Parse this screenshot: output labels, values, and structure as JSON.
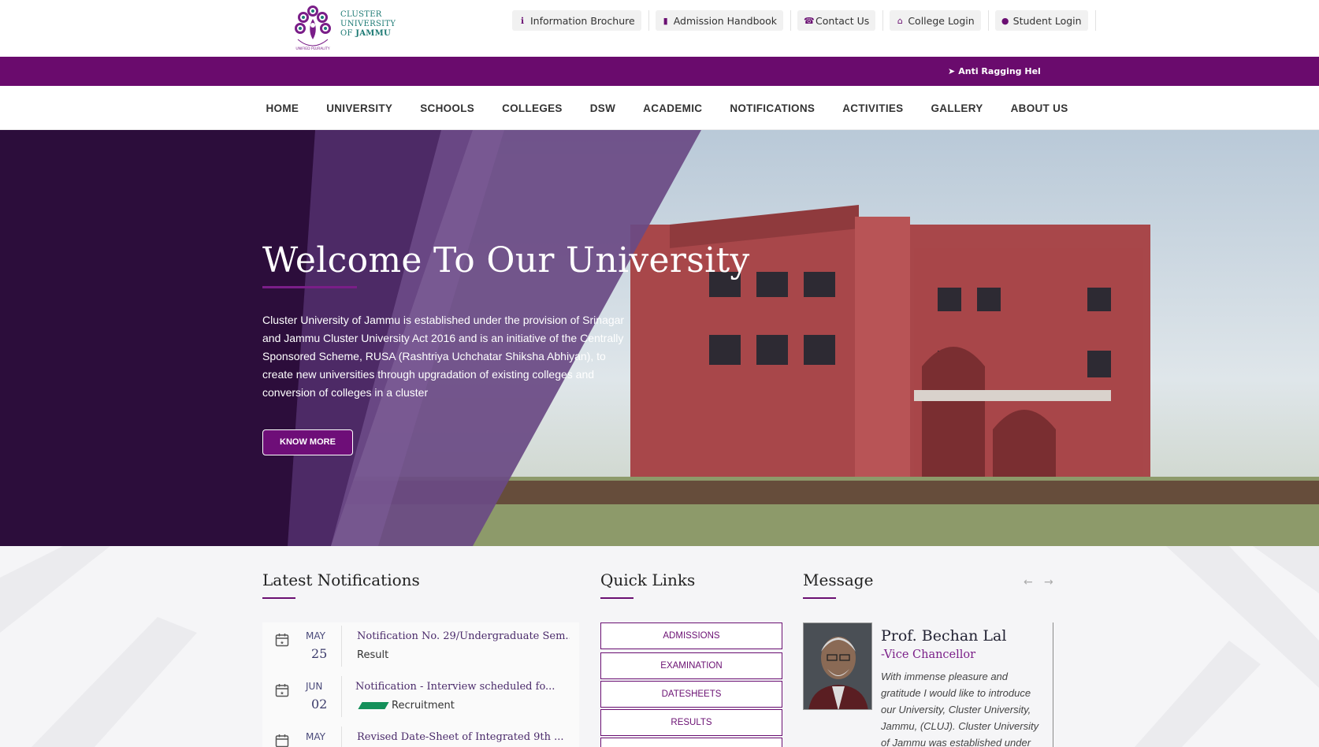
{
  "header": {
    "logo": {
      "line1": "CLUSTER",
      "line2": "UNIVERSITY",
      "line3_prefix": "OF ",
      "line3_bold": "JAMMU",
      "tagline": "UNIFIED PLURALITY"
    },
    "utility_links": [
      {
        "label": "Information Brochure",
        "icon": "info-icon"
      },
      {
        "label": "Admission Handbook",
        "icon": "document-icon"
      },
      {
        "label": "Contact Us",
        "icon": "phone-icon"
      },
      {
        "label": "College Login",
        "icon": "bank-icon"
      },
      {
        "label": "Student Login",
        "icon": "user-icon"
      }
    ]
  },
  "ribbon": {
    "ticker": "Anti Ragging Helplir"
  },
  "nav": {
    "items": [
      "HOME",
      "UNIVERSITY",
      "SCHOOLS",
      "COLLEGES",
      "DSW",
      "ACADEMIC",
      "NOTIFICATIONS",
      "ACTIVITIES",
      "GALLERY",
      "ABOUT US"
    ]
  },
  "hero": {
    "title": "Welcome To Our University",
    "description": "Cluster University of Jammu is established under the provision of Srinagar and Jammu Cluster University Act 2016 and is an initiative of the Centrally Sponsored Scheme, RUSA (Rashtriya Uchchatar Shiksha Abhiyan), to create new universities through upgradation of existing colleges and conversion of colleges in a cluster",
    "button": "KNOW MORE"
  },
  "notifications": {
    "title": "Latest Notifications",
    "items": [
      {
        "month": "MAY",
        "day": "25",
        "title": "Notification No. 29/Undergraduate Sem...",
        "category": "Result",
        "tag": false
      },
      {
        "month": "JUN",
        "day": "02",
        "title": "Notification - Interview scheduled fo...",
        "category": "Recruitment",
        "tag": true
      },
      {
        "month": "MAY",
        "day": "",
        "title": "Revised Date-Sheet of Integrated 9th ...",
        "category": "",
        "tag": false
      }
    ]
  },
  "quick_links": {
    "title": "Quick Links",
    "items": [
      "ADMISSIONS",
      "EXAMINATION",
      "DATESHEETS",
      "RESULTS",
      ""
    ]
  },
  "message": {
    "title": "Message",
    "name": "Prof. Bechan Lal",
    "role": "-Vice Chancellor",
    "text": "With immense pleasure and gratitude I would like to introduce our University, Cluster University, Jammu, (CLUJ). Cluster University of Jammu was established under"
  }
}
